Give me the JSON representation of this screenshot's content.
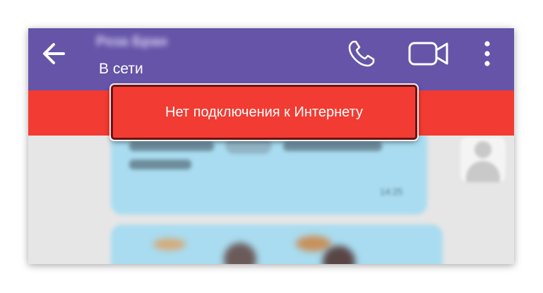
{
  "header": {
    "contact_name": "Роза Бран",
    "status": "В сети",
    "background_color": "#6554a8"
  },
  "icons": {
    "back": "arrow-left-icon",
    "call": "phone-icon",
    "video": "video-camera-icon",
    "more": "more-vertical-icon"
  },
  "banner": {
    "text": "Нет подключения к Интернету",
    "background_color": "#f23b32"
  },
  "chat": {
    "message_time": "14:25",
    "bubble_color": "#a9dcf0"
  }
}
